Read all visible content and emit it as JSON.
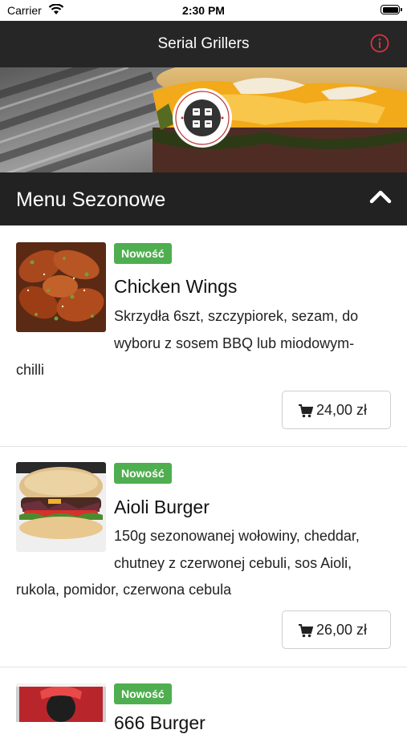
{
  "status_bar": {
    "carrier": "Carrier",
    "time": "2:30 PM"
  },
  "navbar": {
    "title": "Serial Grillers",
    "info_icon": "info-circle-icon"
  },
  "hero": {
    "logo_icon": "serial-grillers-logo"
  },
  "section": {
    "title": "Menu Sezonowe",
    "collapse_icon": "chevron-up-icon"
  },
  "items": [
    {
      "badge": "Nowość",
      "name": "Chicken Wings",
      "desc_lines": [
        "Skrzydła 6szt, szczypiorek, sezam, do",
        "wyboru z sosem BBQ lub miodowym-",
        "chilli"
      ],
      "price": "24,00 zł"
    },
    {
      "badge": "Nowość",
      "name": "Aioli Burger",
      "desc_lines": [
        "150g sezonowanej wołowiny, cheddar,",
        "chutney z czerwonej cebuli, sos Aioli,",
        "rukola, pomidor, czerwona cebula"
      ],
      "price": "26,00 zł"
    },
    {
      "badge": "Nowość",
      "name": "666 Burger"
    }
  ],
  "colors": {
    "navbar": "#262626",
    "section_header": "#222222",
    "badge": "#4fae4f",
    "info_icon": "#d9333f"
  }
}
